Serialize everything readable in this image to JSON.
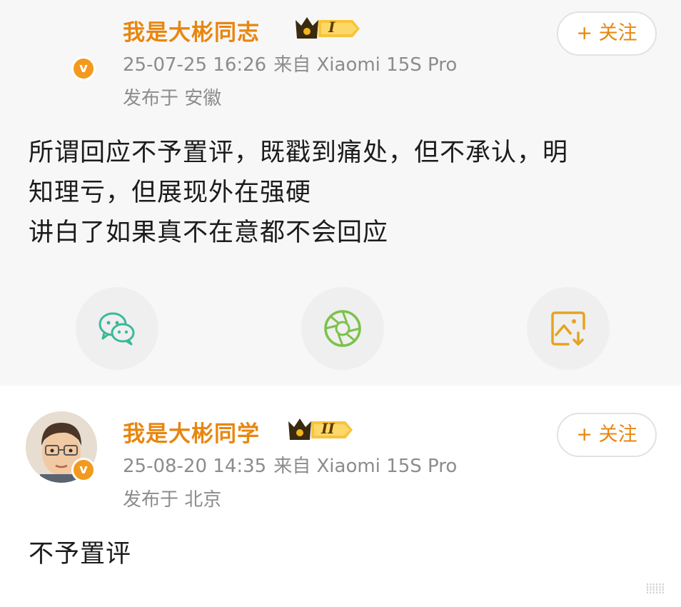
{
  "posts": [
    {
      "username": "我是大彬同志",
      "badge_level": "I",
      "time": "25-07-25 16:26",
      "source": "来自 Xiaomi 15S Pro",
      "location": "发布于 安徽",
      "follow_label": "+ 关注",
      "verified_mark": "v",
      "content_lines": [
        "所谓回应不予置评，既戳到痛处，但不承认，明",
        "知理亏，但展现外在强硬",
        "讲白了如果真不在意都不会回应"
      ],
      "share_icons": [
        "wechat-icon",
        "moments-icon",
        "save-image-icon"
      ]
    },
    {
      "username": "我是大彬同学",
      "badge_level": "II",
      "time": "25-08-20 14:35",
      "source": "来自 Xiaomi 15S Pro",
      "location": "发布于 北京",
      "follow_label": "+ 关注",
      "verified_mark": "v",
      "content_lines": [
        "不予置评"
      ]
    }
  ],
  "colors": {
    "username": "#e8860f",
    "meta": "#8c8c8c",
    "wechat": "#3bb99a",
    "moments": "#7cc24a",
    "save": "#e6a320"
  },
  "watermark": "⁞⁞⁞⁞⁞⁞"
}
